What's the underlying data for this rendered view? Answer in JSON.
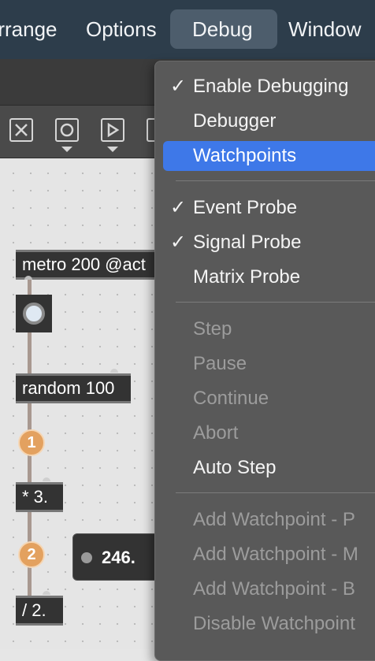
{
  "menubar": {
    "items": [
      {
        "label": "Arrange"
      },
      {
        "label": "Options"
      },
      {
        "label": "Debug"
      },
      {
        "label": "Window"
      }
    ]
  },
  "debug_menu": {
    "items": [
      {
        "label": "Enable Debugging",
        "checked": "✓"
      },
      {
        "label": "Debugger"
      },
      {
        "label": "Watchpoints"
      },
      {
        "label": "Event Probe",
        "checked": "✓"
      },
      {
        "label": "Signal Probe",
        "checked": "✓"
      },
      {
        "label": "Matrix Probe"
      },
      {
        "label": "Step"
      },
      {
        "label": "Pause"
      },
      {
        "label": "Continue"
      },
      {
        "label": "Abort"
      },
      {
        "label": "Auto Step"
      },
      {
        "label": "Add Watchpoint - P"
      },
      {
        "label": "Add Watchpoint - M"
      },
      {
        "label": "Add Watchpoint - B"
      },
      {
        "label": "Disable Watchpoint"
      }
    ]
  },
  "patcher": {
    "objects": {
      "metro": "metro 200 @act",
      "random": "random 100",
      "multiply": "* 3.",
      "divide": "/ 2."
    },
    "number_value": "246.",
    "probes": [
      "1",
      "2"
    ]
  },
  "colors": {
    "menubar": "#2d3d4b",
    "highlight": "#3e78e8",
    "probe": "#e3a15f"
  }
}
